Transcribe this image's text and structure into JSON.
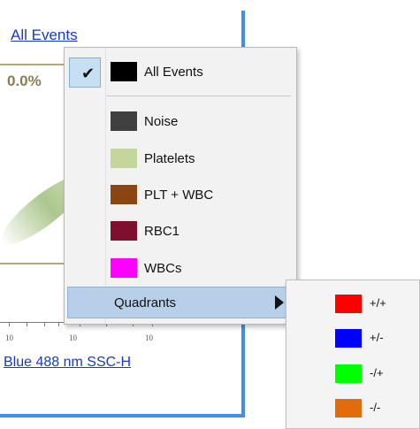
{
  "plot": {
    "title_link": "All Events",
    "percent": "0.0%",
    "x_axis_title": "Blue 488 nm SSC-H",
    "tick_labels": [
      "10",
      "10",
      "10"
    ]
  },
  "menu": {
    "all_events": {
      "label": "All Events",
      "checked": true,
      "color": "#000000"
    },
    "items": [
      {
        "label": "Noise",
        "color": "#404040"
      },
      {
        "label": "Platelets",
        "color": "#c3d69b"
      },
      {
        "label": "PLT + WBC",
        "color": "#8b4513"
      },
      {
        "label": "RBC1",
        "color": "#7f0f2e"
      },
      {
        "label": "WBCs",
        "color": "#ff00ff"
      }
    ],
    "quadrants": {
      "label": "Quadrants",
      "selected": true
    }
  },
  "submenu": {
    "items": [
      {
        "label": "+/+",
        "color": "#ff0000"
      },
      {
        "label": "+/-",
        "color": "#0000ff"
      },
      {
        "label": "-/+",
        "color": "#00ff00"
      },
      {
        "label": "-/-",
        "color": "#e36c0a"
      }
    ]
  }
}
